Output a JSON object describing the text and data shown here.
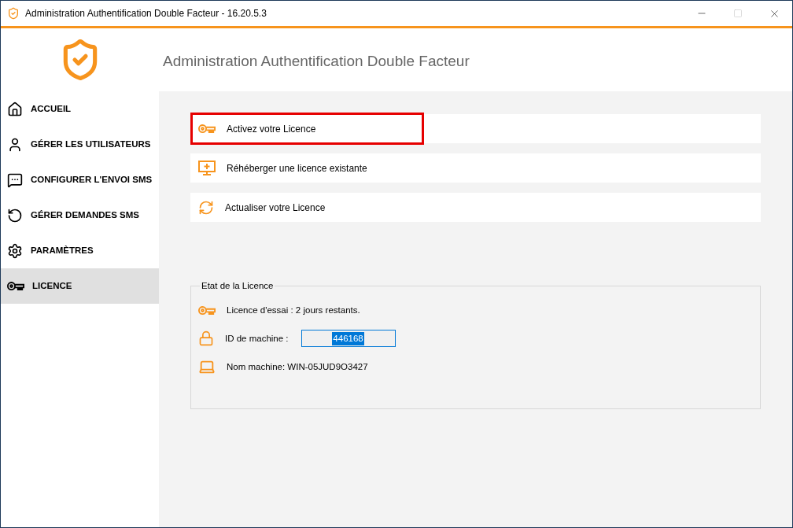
{
  "window": {
    "title": "Administration Authentification Double Facteur - 16.20.5.3"
  },
  "header": {
    "title": "Administration Authentification Double Facteur"
  },
  "sidebar": {
    "items": [
      {
        "label": "ACCUEIL",
        "selected": false
      },
      {
        "label": "GÉRER LES UTILISATEURS",
        "selected": false
      },
      {
        "label": "CONFIGURER L'ENVOI SMS",
        "selected": false
      },
      {
        "label": "GÉRER DEMANDES SMS",
        "selected": false
      },
      {
        "label": "PARAMÈTRES",
        "selected": false
      },
      {
        "label": "LICENCE",
        "selected": true
      }
    ]
  },
  "actions": [
    {
      "label": "Activez votre Licence",
      "highlighted": true
    },
    {
      "label": "Réhéberger une licence existante",
      "highlighted": false
    },
    {
      "label": "Actualiser votre Licence",
      "highlighted": false
    }
  ],
  "licence_status": {
    "title": "Etat de la Licence",
    "rows": [
      {
        "kind": "text",
        "label": "Licence d'essai : 2 jours restants."
      },
      {
        "kind": "field",
        "label": "ID de machine :",
        "value": "446168"
      },
      {
        "kind": "text",
        "label": "Nom machine: WIN-05JUD9O3427"
      }
    ]
  }
}
